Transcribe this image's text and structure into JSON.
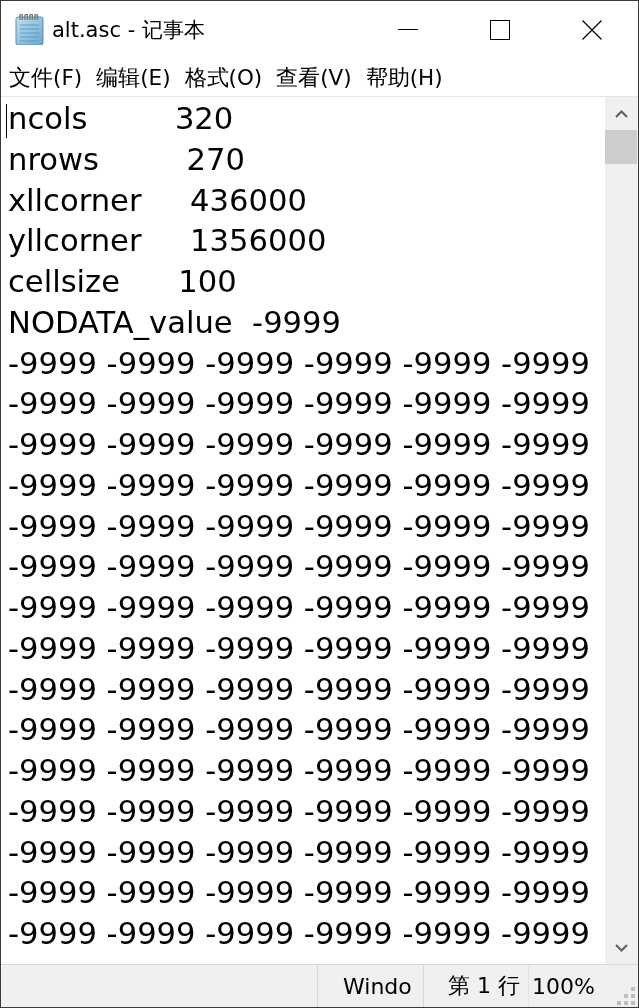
{
  "window": {
    "title": "alt.asc - 记事本"
  },
  "menu_bar": {
    "items": [
      "文件(F)",
      "编辑(E)",
      "格式(O)",
      "查看(V)",
      "帮助(H)"
    ]
  },
  "editor": {
    "lines": [
      "ncols         320",
      "nrows         270",
      "xllcorner     436000",
      "yllcorner     1356000",
      "cellsize      100",
      "NODATA_value  -9999",
      "-9999 -9999 -9999 -9999 -9999 -9999",
      "-9999 -9999 -9999 -9999 -9999 -9999",
      "-9999 -9999 -9999 -9999 -9999 -9999",
      "-9999 -9999 -9999 -9999 -9999 -9999",
      "-9999 -9999 -9999 -9999 -9999 -9999",
      "-9999 -9999 -9999 -9999 -9999 -9999",
      "-9999 -9999 -9999 -9999 -9999 -9999",
      "-9999 -9999 -9999 -9999 -9999 -9999",
      "-9999 -9999 -9999 -9999 -9999 -9999",
      "-9999 -9999 -9999 -9999 -9999 -9999",
      "-9999 -9999 -9999 -9999 -9999 -9999",
      "-9999 -9999 -9999 -9999 -9999 -9999",
      "-9999 -9999 -9999 -9999 -9999 -9999",
      "-9999 -9999 -9999 -9999 -9999 -9999",
      "-9999 -9999 -9999 -9999 -9999 -9999"
    ]
  },
  "status_bar": {
    "cells": [
      "Windo",
      "第 1 行",
      "100%"
    ]
  }
}
